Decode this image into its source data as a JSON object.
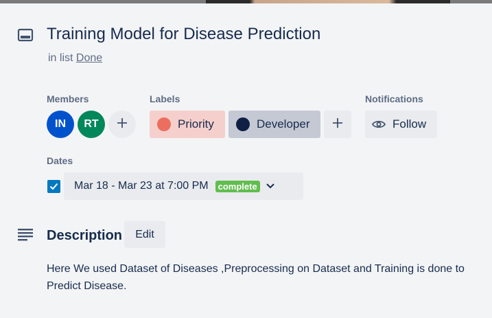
{
  "card": {
    "title": "Training Model for Disease Prediction",
    "in_list_prefix": "in list",
    "list_name": "Done"
  },
  "members": {
    "label": "Members",
    "avatars": [
      {
        "initials": "IN",
        "color": "#0052cc"
      },
      {
        "initials": "RT",
        "color": "#00875a"
      }
    ],
    "add_icon": "plus-icon"
  },
  "labels": {
    "label": "Labels",
    "items": [
      {
        "name": "Priority",
        "dot_color": "#eb6e5f",
        "bg_color": "#f5cfcb"
      },
      {
        "name": "Developer",
        "dot_color": "#0f1f45",
        "bg_color": "#c5c9d3"
      }
    ],
    "add_icon": "plus-icon"
  },
  "notifications": {
    "label": "Notifications",
    "follow_label": "Follow",
    "icon": "eye-icon"
  },
  "dates": {
    "label": "Dates",
    "checked": true,
    "value": "Mar 18 - Mar 23 at 7:00 PM",
    "status": "complete",
    "status_color": "#61bd4f"
  },
  "description": {
    "title": "Description",
    "edit_label": "Edit",
    "text": "Here We used Dataset of Diseases ,Preprocessing on Dataset and Training is done to Predict Disease."
  }
}
